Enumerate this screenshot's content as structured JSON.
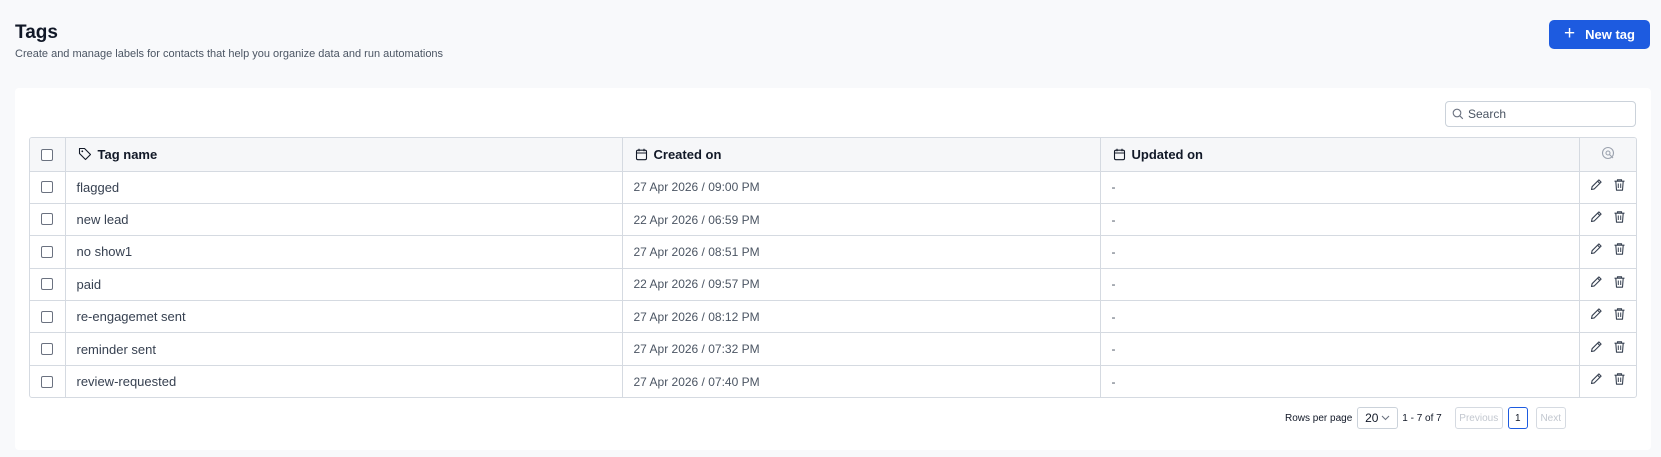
{
  "header": {
    "title": "Tags",
    "subtitle": "Create and manage labels for contacts that help you organize data and run automations",
    "new_tag_label": "New tag"
  },
  "search": {
    "placeholder": "Search"
  },
  "table": {
    "columns": {
      "name": "Tag name",
      "created": "Created on",
      "updated": "Updated on"
    },
    "rows": [
      {
        "name": "flagged",
        "created": "27 Apr 2026 / 09:00 PM",
        "updated": "-"
      },
      {
        "name": "new lead",
        "created": "22 Apr 2026 / 06:59 PM",
        "updated": "-"
      },
      {
        "name": "no show1",
        "created": "27 Apr 2026 / 08:51 PM",
        "updated": "-"
      },
      {
        "name": "paid",
        "created": "22 Apr 2026 / 09:57 PM",
        "updated": "-"
      },
      {
        "name": "re-engagemet sent",
        "created": "27 Apr 2026 / 08:12 PM",
        "updated": "-"
      },
      {
        "name": "reminder sent",
        "created": "27 Apr 2026 / 07:32 PM",
        "updated": "-"
      },
      {
        "name": "review-requested",
        "created": "27 Apr 2026 / 07:40 PM",
        "updated": "-"
      }
    ]
  },
  "pagination": {
    "rows_per_page_label": "Rows per page",
    "rows_per_page_value": "20",
    "range_text": "1 - 7 of 7",
    "previous_label": "Previous",
    "current_page": "1",
    "next_label": "Next"
  },
  "icons": {
    "plus": "plus-icon",
    "search": "search-icon",
    "tag": "tag-icon",
    "calendar": "calendar-icon",
    "settings": "columns-settings-icon",
    "edit": "pencil-icon",
    "delete": "trash-icon",
    "chevron": "chevron-down-icon"
  },
  "colors": {
    "primary": "#1d5be0",
    "background": "#f8f9fb",
    "border": "#d5dae1"
  }
}
